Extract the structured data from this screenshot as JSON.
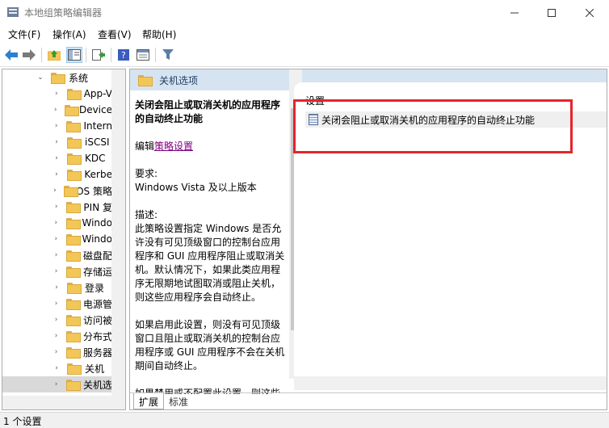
{
  "window": {
    "title": "本地组策略编辑器"
  },
  "menu": [
    "文件(F)",
    "操作(A)",
    "查看(V)",
    "帮助(H)"
  ],
  "toolbar": {
    "icons": [
      "back-icon",
      "forward-icon",
      "up-folder-icon",
      "show-hide-tree-icon",
      "export-list-icon",
      "help-icon",
      "properties-icon",
      "filter-icon"
    ]
  },
  "tree": {
    "parent": "系统",
    "items": [
      "App-V",
      "Device",
      "Intern",
      "iSCSI",
      "KDC",
      "Kerbe",
      "OS 策略",
      "PIN 复",
      "Windo",
      "Windo",
      "磁盘配",
      "存储运",
      "登录",
      "电源管",
      "访问被",
      "分布式",
      "服务器",
      "关机",
      "关机选"
    ],
    "selected_index": 18
  },
  "pane": {
    "header_title": "关机选项",
    "description": {
      "title": "关闭会阻止或取消关机的应用程序的自动终止功能",
      "edit_prefix": "编辑",
      "edit_link": "策略设置",
      "requirements_label": "要求:",
      "requirements_value": "Windows Vista 及以上版本",
      "description_label": "描述:",
      "description_text": "此策略设置指定 Windows 是否允许没有可见顶级窗口的控制台应用程序和 GUI 应用程序阻止或取消关机。默认情况下，如果此类应用程序无限期地试图取消或阻止关机，则这些应用程序会自动终止。",
      "enabled_text": "如果启用此设置，则没有可见顶级窗口且阻止或取消关机的控制台应用程序或 GUI 应用程序不会在关机期间自动终止。",
      "cut_text": "如果禁用或不配置此设置，则这些"
    },
    "settings_header": "设置",
    "settings_row": "关闭会阻止或取消关机的应用程序的自动终止功能",
    "tabs": [
      "扩展",
      "标准"
    ]
  },
  "status": {
    "text": "1 个设置"
  },
  "colors": {
    "highlight": "#e4252d",
    "header_bg": "#d6e4f2"
  }
}
